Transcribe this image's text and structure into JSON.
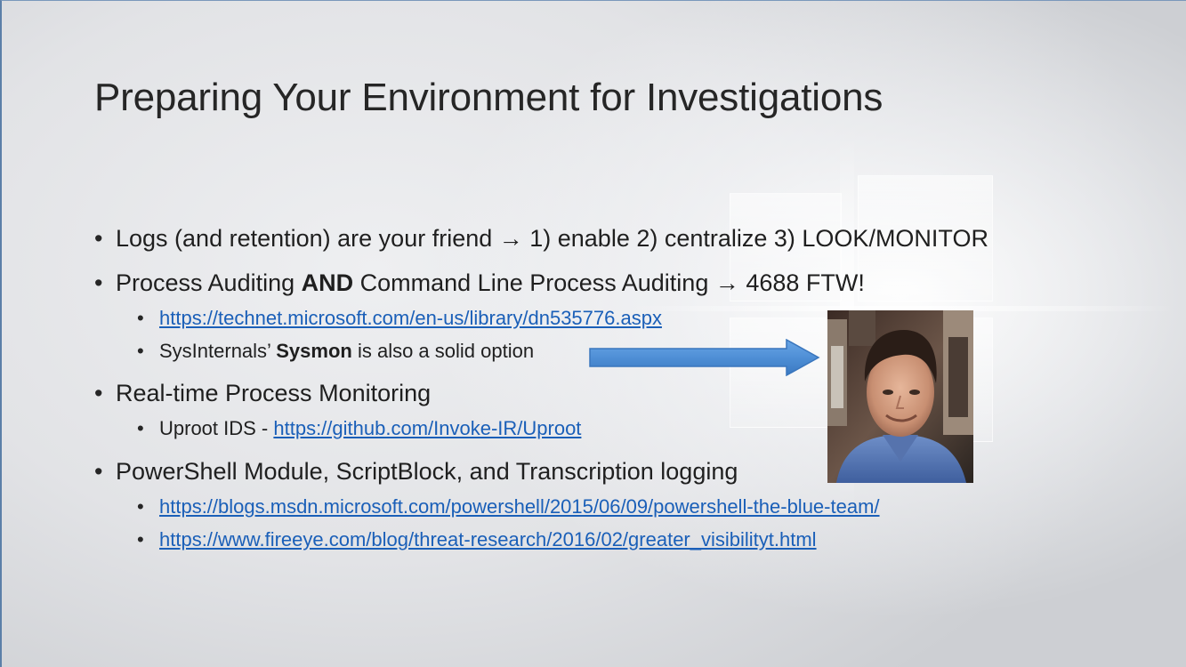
{
  "slide": {
    "title": "Preparing Your Environment for Investigations",
    "bullets": [
      {
        "level": 1,
        "prefix": "Logs (and retention) are your friend ",
        "arrow": "→",
        "suffix": " 1) enable 2) centralize 3) LOOK/MONITOR"
      },
      {
        "level": 1,
        "prefix": "Process Auditing ",
        "bold": "AND",
        "middle": " Command Line Process Auditing ",
        "arrow": "→",
        "suffix": " 4688 FTW!"
      },
      {
        "level": 2,
        "link": "https://technet.microsoft.com/en-us/library/dn535776.aspx"
      },
      {
        "level": 2,
        "prefix": "SysInternals’ ",
        "bold": "Sysmon",
        "suffix": " is also a solid option"
      },
      {
        "level": 1,
        "text": "Real-time Process Monitoring"
      },
      {
        "level": 2,
        "prefix": "Uproot IDS - ",
        "link": "https://github.com/Invoke-IR/Uproot"
      },
      {
        "level": 1,
        "text": "PowerShell Module, ScriptBlock, and Transcription logging"
      },
      {
        "level": 2,
        "link": "https://blogs.msdn.microsoft.com/powershell/2015/06/09/powershell-the-blue-team/"
      },
      {
        "level": 2,
        "link": "https://www.fireeye.com/blog/threat-research/2016/02/greater_visibilityt.html"
      }
    ],
    "bullet_glyph": "•"
  },
  "colors": {
    "link": "#1a5fb8",
    "arrow_fill": "#4f8fd6",
    "arrow_stroke": "#3a76bd",
    "title": "#262626"
  },
  "icons": {
    "callout": "right-arrow-icon",
    "photo": "presenter-photo"
  }
}
